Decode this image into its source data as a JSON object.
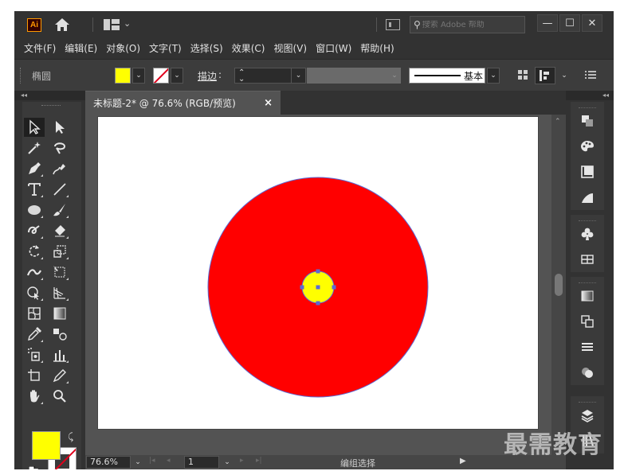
{
  "app": {
    "logo_text": "Ai"
  },
  "titlebar": {
    "search_placeholder": "搜索 Adobe 帮助",
    "minimize": "—",
    "maximize": "☐",
    "close": "✕"
  },
  "menu": {
    "items": [
      "文件(F)",
      "编辑(E)",
      "对象(O)",
      "文字(T)",
      "选择(S)",
      "效果(C)",
      "视图(V)",
      "窗口(W)",
      "帮助(H)"
    ]
  },
  "control_bar": {
    "shape_label": "椭圆",
    "fill_color": "#ffff00",
    "stroke_label": "描边",
    "stroke_value": "",
    "brush_label": "基本"
  },
  "document": {
    "tab_title": "未标题-2* @ 76.6% (RGB/预览)",
    "close": "×"
  },
  "artwork": {
    "outer_circle_color": "#ff0000",
    "inner_circle_color": "#ffff00",
    "selection_color": "#5a6bd6"
  },
  "status_bar": {
    "zoom": "76.6%",
    "artboard_number": "1",
    "status_text": "编组选择"
  },
  "watermark": "最需教育"
}
